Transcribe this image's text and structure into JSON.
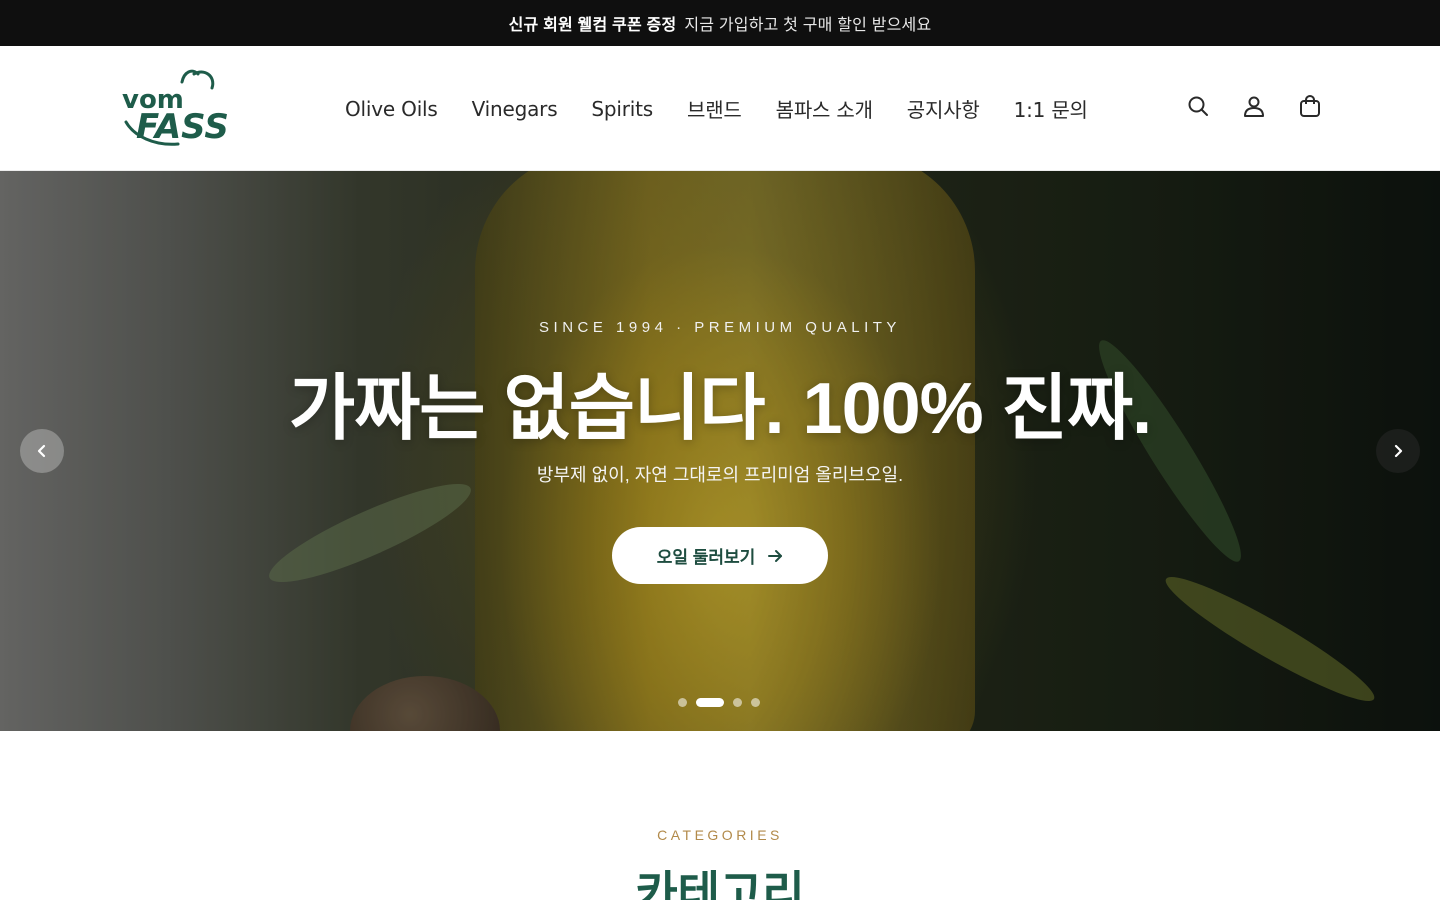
{
  "announcement": {
    "highlight": "신규 회원 웰컴 쿠폰 증정",
    "text": "지금 가입하고 첫 구매 할인 받으세요"
  },
  "header": {
    "logo": {
      "line1": "vom",
      "line2": "FASS",
      "color": "#1e5c4a"
    },
    "nav": [
      "Olive Oils",
      "Vinegars",
      "Spirits",
      "브랜드",
      "봄파스 소개",
      "공지사항",
      "1:1 문의"
    ],
    "icons": [
      "search-icon",
      "user-icon",
      "bag-icon"
    ]
  },
  "hero": {
    "kicker": "SINCE 1994 · PREMIUM QUALITY",
    "headline": "가짜는 없습니다. 100% 진짜.",
    "subline": "방부제 없이, 자연 그대로의 프리미엄 올리브오일.",
    "cta_label": "오일 둘러보기",
    "slide_count": 4,
    "active_slide": 2
  },
  "categories": {
    "kicker": "CATEGORIES",
    "title": "카테고리"
  },
  "colors": {
    "brand_green": "#1e5c4a",
    "accent_gold": "#b28a4a",
    "announce_bg": "#0f0f0f"
  }
}
